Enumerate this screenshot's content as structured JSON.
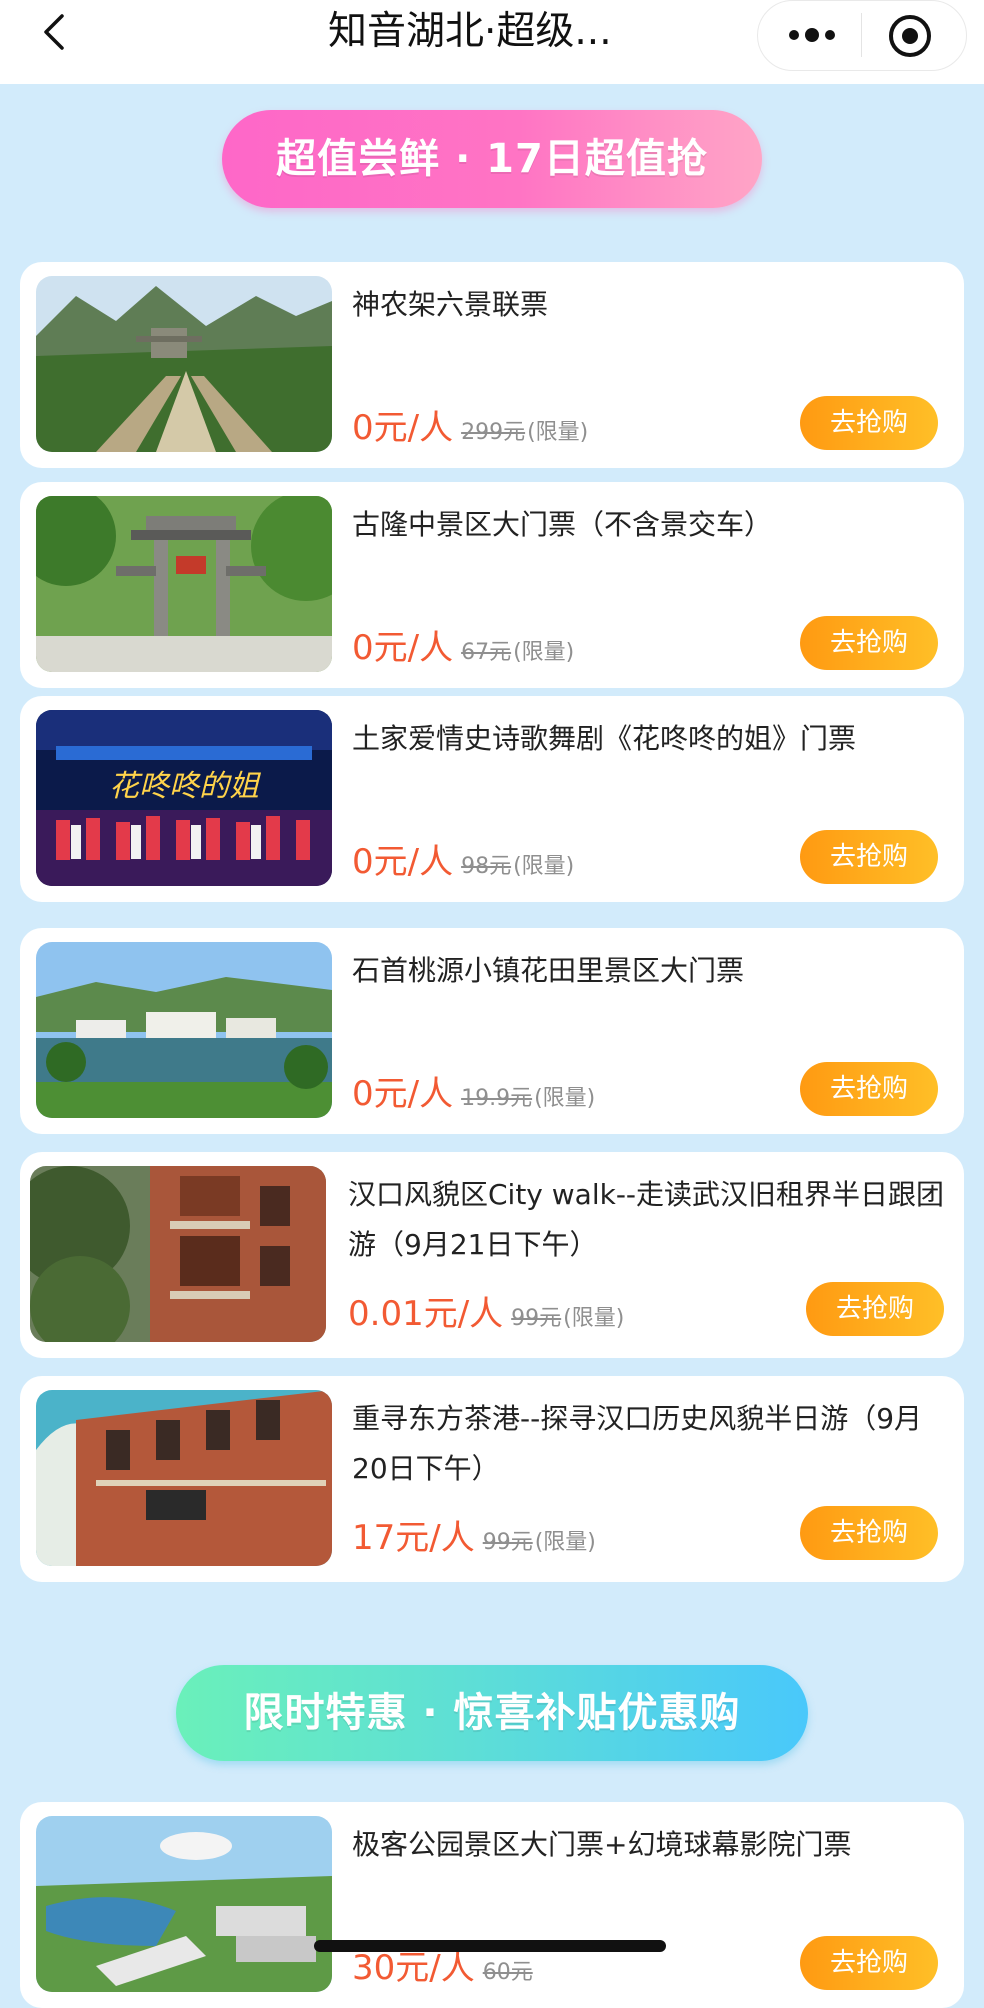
{
  "header": {
    "title": "知音湖北·超级..."
  },
  "sections": [
    {
      "title": "超值尝鲜 · 17日超值抢"
    },
    {
      "title": "限时特惠 · 惊喜补贴优惠购"
    }
  ],
  "products": [
    {
      "name": "神农架六景联票",
      "price": "0元/人",
      "original": "299元",
      "limit": "(限量)",
      "button": "去抢购"
    },
    {
      "name": "古隆中景区大门票（不含景交车）",
      "price": "0元/人",
      "original": "67元",
      "limit": "(限量)",
      "button": "去抢购"
    },
    {
      "name": "土家爱情史诗歌舞剧《花咚咚的姐》门票",
      "price": "0元/人",
      "original": "98元",
      "limit": "(限量)",
      "button": "去抢购"
    },
    {
      "name": "石首桃源小镇花田里景区大门票",
      "price": "0元/人",
      "original": "19.9元",
      "limit": "(限量)",
      "button": "去抢购"
    },
    {
      "name": "汉口风貌区City walk--走读武汉旧租界半日跟团游（9月21日下午）",
      "price": "0.01元/人",
      "original": "99元",
      "limit": "(限量)",
      "button": "去抢购"
    },
    {
      "name": "重寻东方茶港--探寻汉口历史风貌半日游（9月20日下午）",
      "price": "17元/人",
      "original": "99元",
      "limit": "(限量)",
      "button": "去抢购"
    },
    {
      "name": "极客公园景区大门票+幻境球幕影院门票",
      "price": "30元/人",
      "original": "60元",
      "limit": "",
      "button": "去抢购"
    }
  ],
  "show_poster_text": "花咚咚的姐",
  "colors": {
    "page_bg": "#d2ebfb",
    "price": "#f25a33",
    "button": "#ffa31a",
    "banner1": "#ff70c6",
    "banner2": "#55d8e0"
  },
  "icons": [
    "back-arrow-icon",
    "more-dots-icon",
    "target-icon"
  ]
}
